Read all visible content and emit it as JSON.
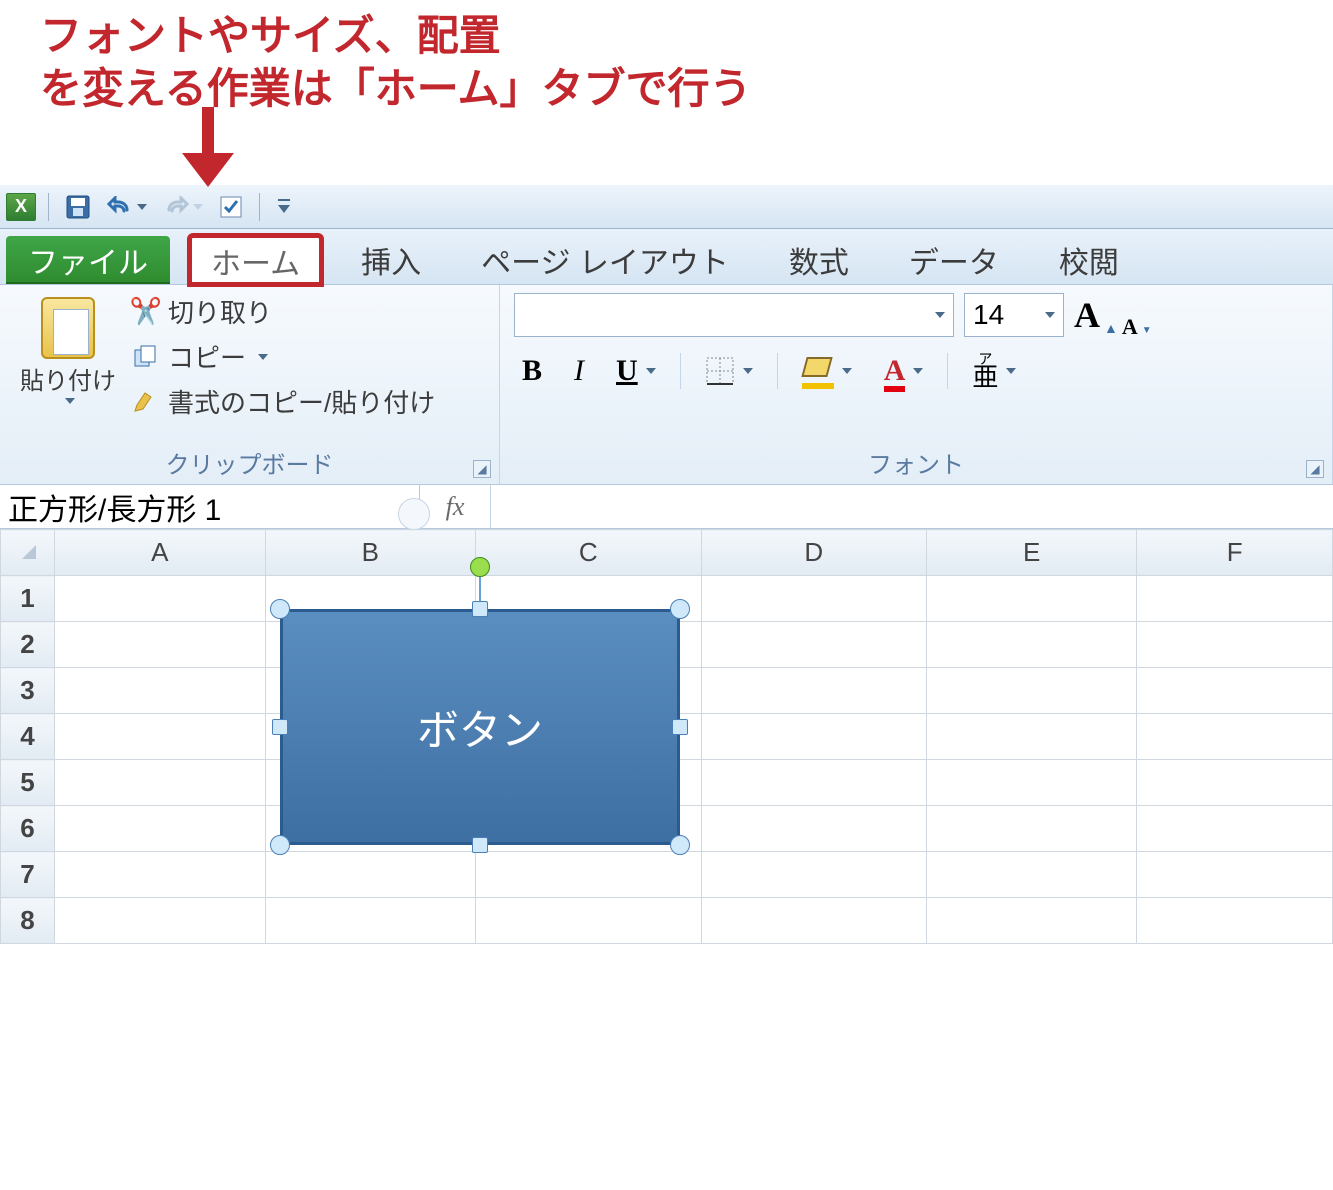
{
  "annotation": {
    "line1": "フォントやサイズ、配置",
    "line2": "を変える作業は「ホーム」タブで行う"
  },
  "qat": {
    "app_icon_letter": "X"
  },
  "tabs": {
    "file": "ファイル",
    "home": "ホーム",
    "insert": "挿入",
    "page_layout": "ページ レイアウト",
    "formulas": "数式",
    "data": "データ",
    "review": "校閲"
  },
  "ribbon": {
    "clipboard": {
      "paste": "貼り付け",
      "cut": "切り取り",
      "copy": "コピー",
      "format_painter": "書式のコピー/貼り付け",
      "group_label": "クリップボード"
    },
    "font": {
      "font_name": "",
      "font_size": "14",
      "group_label": "フォント",
      "ruby_top": "ア",
      "ruby_bottom": "亜",
      "bold": "B",
      "italic": "I",
      "underline": "U",
      "grow_A": "A",
      "shrink_A": "A",
      "fontcolor_A": "A"
    }
  },
  "formula_bar": {
    "name_box": "正方形/長方形 1",
    "fx_label": "fx",
    "formula": ""
  },
  "columns": [
    "A",
    "B",
    "C",
    "D",
    "E",
    "F"
  ],
  "rows": [
    "1",
    "2",
    "3",
    "4",
    "5",
    "6",
    "7",
    "8"
  ],
  "shape": {
    "text": "ボタン"
  }
}
